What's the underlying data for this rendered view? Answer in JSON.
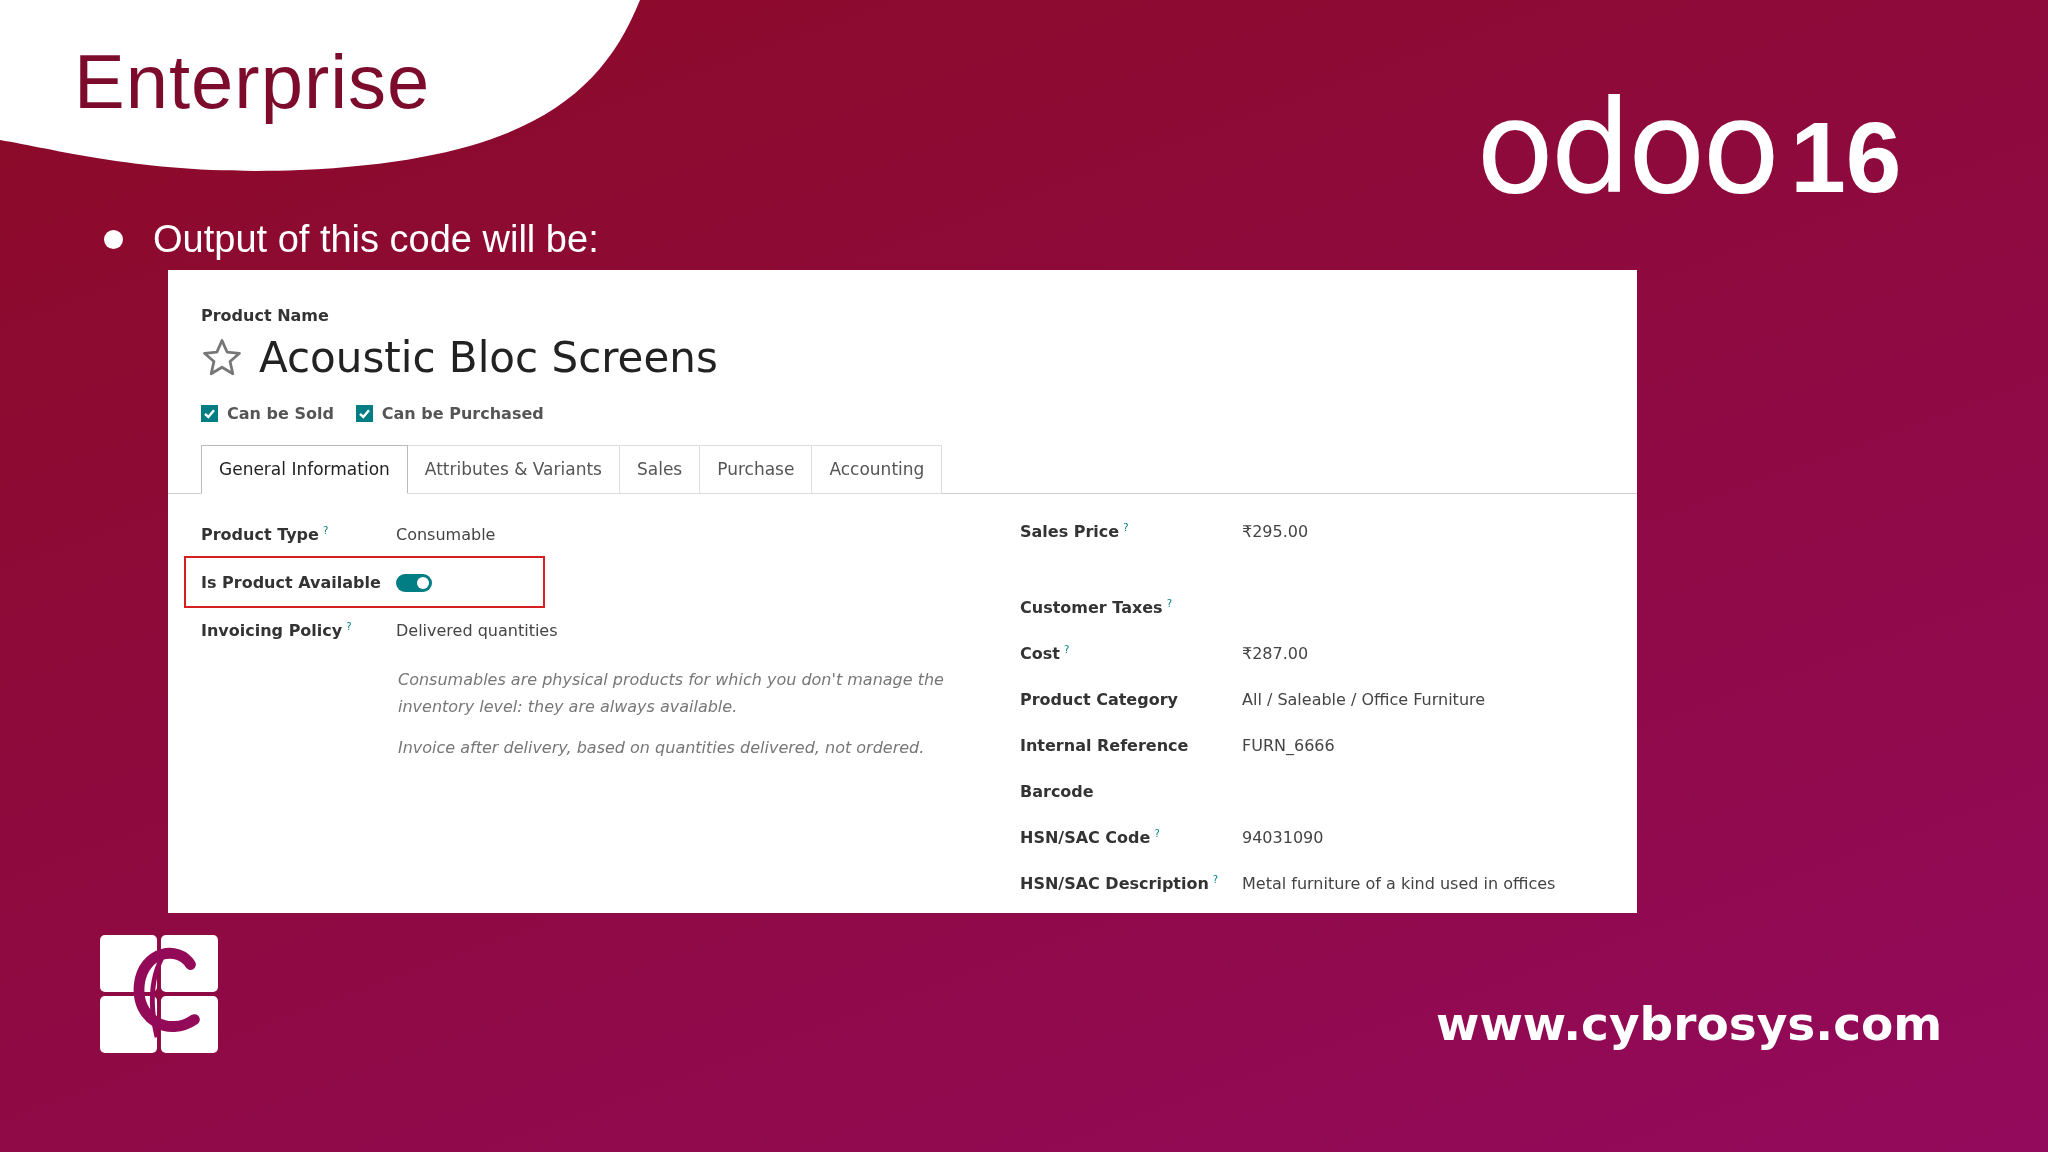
{
  "slide": {
    "title": "Enterprise",
    "brand": {
      "name": "odoo",
      "version": "16"
    },
    "bullet": "Output of this code will be:",
    "footer_url": "www.cybrosys.com"
  },
  "form": {
    "name_label": "Product Name",
    "product_name": "Acoustic Bloc Screens",
    "favorite": false,
    "options": [
      {
        "label": "Can be Sold",
        "checked": true
      },
      {
        "label": "Can be Purchased",
        "checked": true
      }
    ],
    "tabs": [
      {
        "label": "General Information",
        "selected": true
      },
      {
        "label": "Attributes & Variants",
        "selected": false
      },
      {
        "label": "Sales",
        "selected": false
      },
      {
        "label": "Purchase",
        "selected": false
      },
      {
        "label": "Accounting",
        "selected": false
      }
    ],
    "left_fields": [
      {
        "kind": "text",
        "label": "Product Type",
        "help_mark": "?",
        "value": "Consumable",
        "highlighted": false
      },
      {
        "kind": "toggle",
        "label": "Is Product Available",
        "on": true,
        "highlighted": true
      },
      {
        "kind": "text",
        "label": "Invoicing Policy",
        "help_mark": "?",
        "value": "Delivered quantities",
        "highlighted": false
      }
    ],
    "notes": [
      "Consumables are physical products for which you don't manage the inventory level: they are always available.",
      "Invoice after delivery, based on quantities delivered, not ordered."
    ],
    "right_fields": [
      {
        "label": "Sales Price",
        "help_mark": "?",
        "value": "₹295.00"
      },
      {
        "label": "Customer Taxes",
        "help_mark": "?"
      },
      {
        "label": "Cost",
        "help_mark": "?",
        "value": "₹287.00"
      },
      {
        "label": "Product Category",
        "value": "All / Saleable / Office Furniture"
      },
      {
        "label": "Internal Reference",
        "value": "FURN_6666"
      },
      {
        "label": "Barcode"
      },
      {
        "label": "HSN/SAC Code",
        "help_mark": "?",
        "value": "94031090"
      },
      {
        "label": "HSN/SAC Description",
        "help_mark": "?",
        "value": "Metal furniture of a kind used in offices"
      }
    ]
  }
}
